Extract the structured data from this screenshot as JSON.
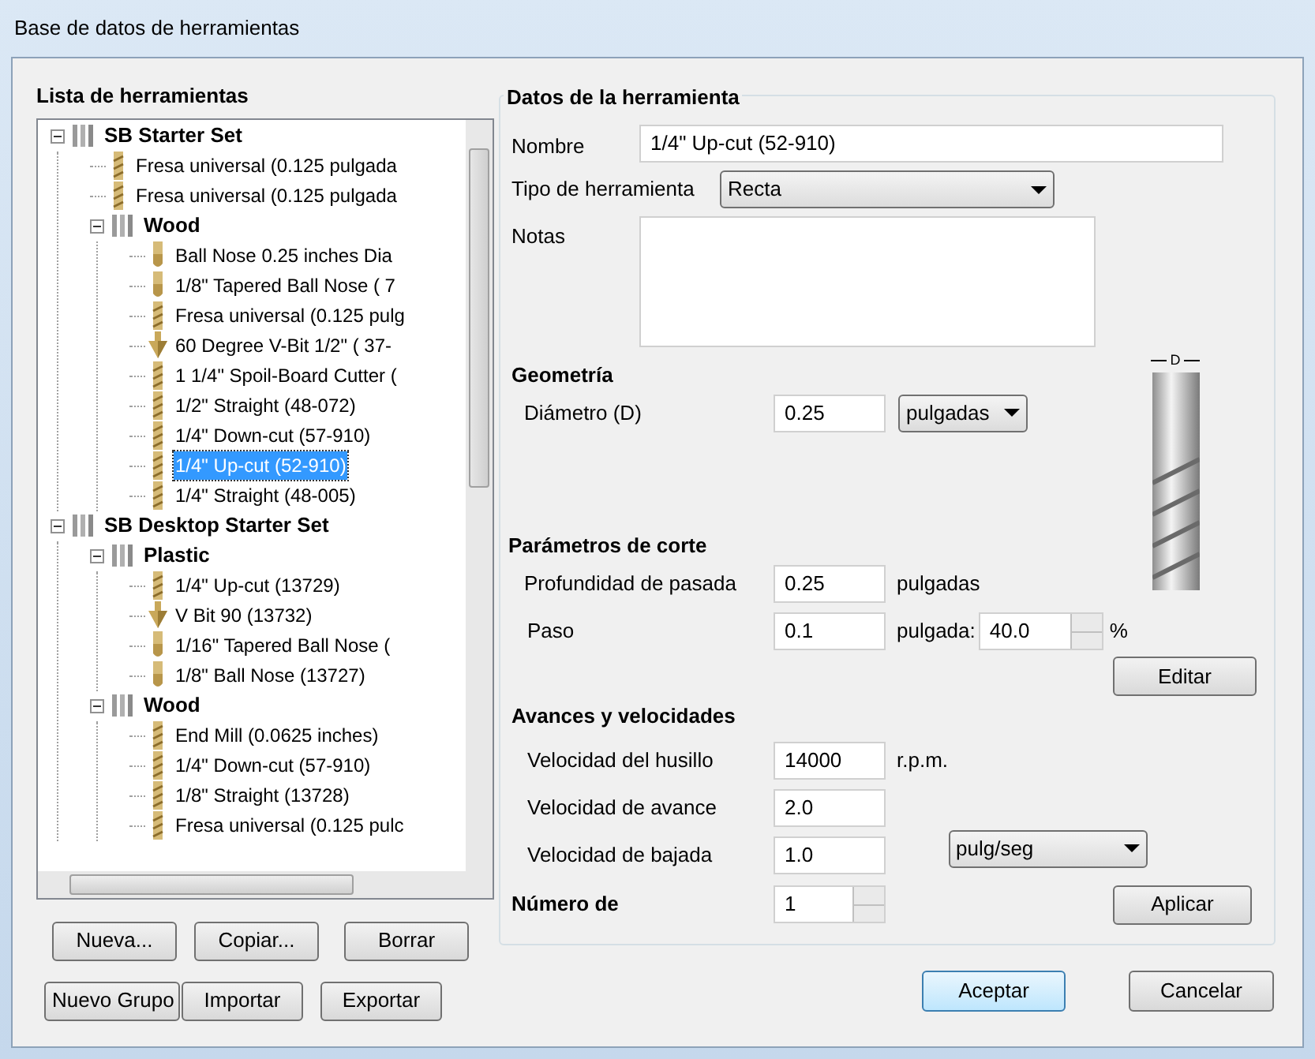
{
  "window": {
    "title": "Base de datos de herramientas"
  },
  "tool_list": {
    "title": "Lista de herramientas",
    "tree": [
      {
        "kind": "group",
        "label": "SB Starter Set",
        "expanded": true,
        "children": [
          {
            "kind": "straight",
            "label": "Fresa universal (0.125 pulgada",
            "selected": false
          },
          {
            "kind": "straight",
            "label": "Fresa universal (0.125 pulgada",
            "selected": false
          },
          {
            "kind": "group",
            "label": "Wood",
            "expanded": true,
            "children": [
              {
                "kind": "ballnose",
                "label": "Ball Nose 0.25 inches Dia",
                "selected": false
              },
              {
                "kind": "ballnose",
                "label": "1/8\" Tapered Ball Nose ( 7",
                "selected": false
              },
              {
                "kind": "straight",
                "label": "Fresa universal (0.125 pulg",
                "selected": false
              },
              {
                "kind": "vbit",
                "label": "60 Degree V-Bit 1/2\"  ( 37-",
                "selected": false
              },
              {
                "kind": "straight",
                "label": "1 1/4\" Spoil-Board Cutter (",
                "selected": false
              },
              {
                "kind": "straight",
                "label": "1/2\" Straight  (48-072)",
                "selected": false
              },
              {
                "kind": "straight",
                "label": "1/4\"  Down-cut (57-910)",
                "selected": false
              },
              {
                "kind": "straight",
                "label": "1/4\" Up-cut (52-910)",
                "selected": true
              },
              {
                "kind": "straight",
                "label": "1/4\" Straight  (48-005)",
                "selected": false
              }
            ]
          }
        ]
      },
      {
        "kind": "group",
        "label": "SB Desktop Starter Set",
        "expanded": true,
        "children": [
          {
            "kind": "group",
            "label": "Plastic",
            "expanded": true,
            "children": [
              {
                "kind": "straight",
                "label": "1/4\" Up-cut (13729)",
                "selected": false
              },
              {
                "kind": "vbit",
                "label": "V Bit 90 (13732)",
                "selected": false
              },
              {
                "kind": "ballnose",
                "label": "1/16\" Tapered Ball Nose (",
                "selected": false
              },
              {
                "kind": "ballnose",
                "label": "1/8\" Ball Nose (13727)",
                "selected": false
              }
            ]
          },
          {
            "kind": "group",
            "label": "Wood",
            "expanded": true,
            "children": [
              {
                "kind": "straight",
                "label": "End Mill (0.0625 inches)",
                "selected": false
              },
              {
                "kind": "straight",
                "label": "1/4\"  Down-cut (57-910)",
                "selected": false
              },
              {
                "kind": "straight",
                "label": "1/8\" Straight (13728)",
                "selected": false
              },
              {
                "kind": "straight",
                "label": "Fresa universal (0.125 pulc",
                "selected": false
              }
            ]
          }
        ]
      }
    ],
    "buttons": [
      [
        "Nueva...",
        "Copiar...",
        "Borrar"
      ],
      [
        "Nuevo Grupo",
        "Importar",
        "Exportar"
      ]
    ]
  },
  "tool_data": {
    "title": "Datos de la herramienta",
    "name": {
      "label": "Nombre",
      "value": "1/4\" Up-cut (52-910)"
    },
    "tool_type": {
      "label": "Tipo de herramienta",
      "value": "Recta"
    },
    "notes": {
      "label": "Notas"
    },
    "diagram_label": "D",
    "geometry": {
      "title": "Geometría",
      "diameter": {
        "label": "Diámetro (D)",
        "value": "0.25",
        "unit": "pulgadas"
      }
    },
    "cutting": {
      "title": "Parámetros de corte",
      "pass_depth": {
        "label": "Profundidad de pasada",
        "value": "0.25",
        "unit": "pulgadas"
      },
      "stepover": {
        "label": "Paso",
        "value": "0.1",
        "unit": "pulgada:",
        "percent": "40.0",
        "percent_sign": "%"
      },
      "edit_button": "Editar"
    },
    "feeds": {
      "title": "Avances y velocidades",
      "spindle": {
        "label": "Velocidad del husillo",
        "value": "14000",
        "unit": "r.p.m."
      },
      "feed": {
        "label": "Velocidad de avance",
        "value": "2.0"
      },
      "plunge": {
        "label": "Velocidad de bajada",
        "value": "1.0"
      },
      "rate_unit": "pulg/seg"
    },
    "tool_number": {
      "label": "Número de",
      "value": "1"
    },
    "apply_button": "Aplicar"
  },
  "footer": {
    "ok": "Aceptar",
    "cancel": "Cancelar"
  }
}
